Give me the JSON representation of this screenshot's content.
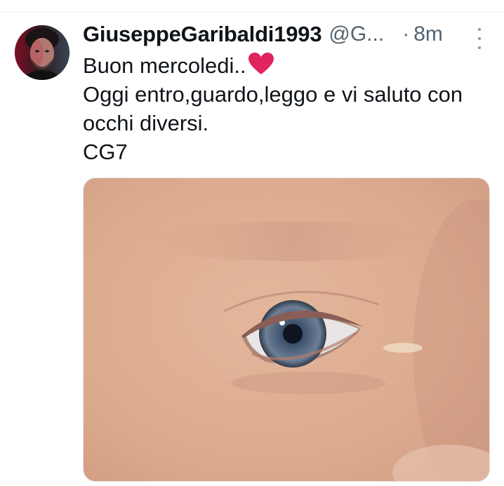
{
  "tweet": {
    "display_name": "GiuseppeGaribaldi1993",
    "handle": "@G...",
    "separator": "·",
    "timestamp": "8m",
    "text_lines": [
      "Buon mercoledi..",
      "Oggi entro,guardo,leggo e vi saluto con",
      "occhi diversi.",
      "CG7"
    ],
    "heart_emoji": "heart-emoji",
    "more_icon": "more-vertical-icon"
  },
  "colors": {
    "text_primary": "#0f1419",
    "text_secondary": "#536471",
    "heart": "#e0245e",
    "divider": "#eff3f4"
  }
}
